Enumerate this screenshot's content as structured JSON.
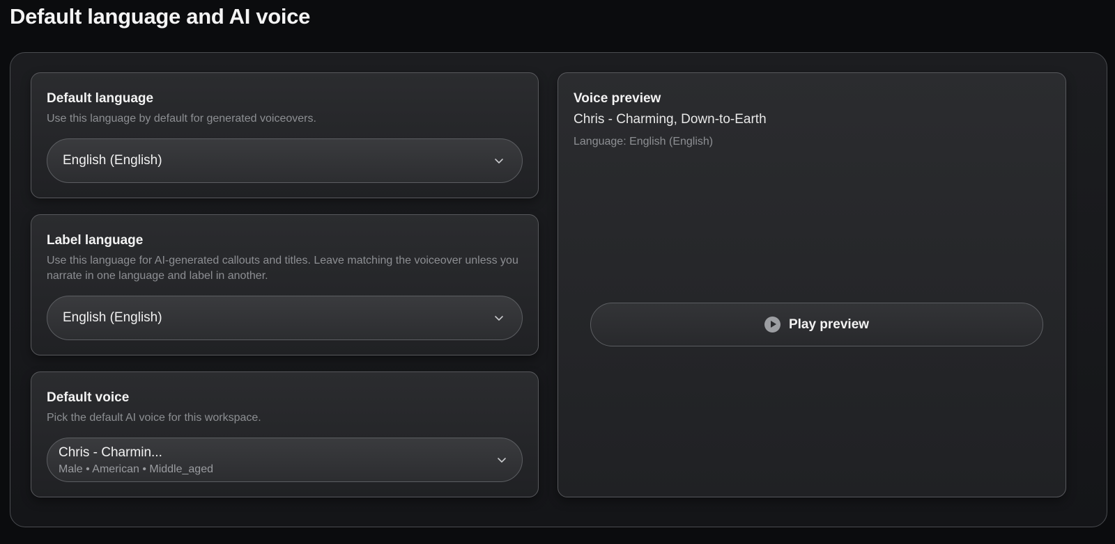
{
  "page": {
    "title": "Default language and AI voice"
  },
  "default_language": {
    "title": "Default language",
    "description": "Use this language by default for generated voiceovers.",
    "selected": "English (English)"
  },
  "label_language": {
    "title": "Label language",
    "description": "Use this language for AI-generated callouts and titles. Leave matching the voiceover unless you narrate in one language and label in another.",
    "selected": "English (English)"
  },
  "default_voice": {
    "title": "Default voice",
    "description": "Pick the default AI voice for this workspace.",
    "selected_name": "Chris - Charmin...",
    "selected_meta": "Male • American • Middle_aged"
  },
  "voice_preview": {
    "title": "Voice preview",
    "voice_name": "Chris - Charming, Down-to-Earth",
    "language": "Language: English (English)",
    "play_label": "Play preview"
  },
  "icons": {
    "chevron": "chevron-down-icon",
    "play": "play-circle-icon"
  }
}
